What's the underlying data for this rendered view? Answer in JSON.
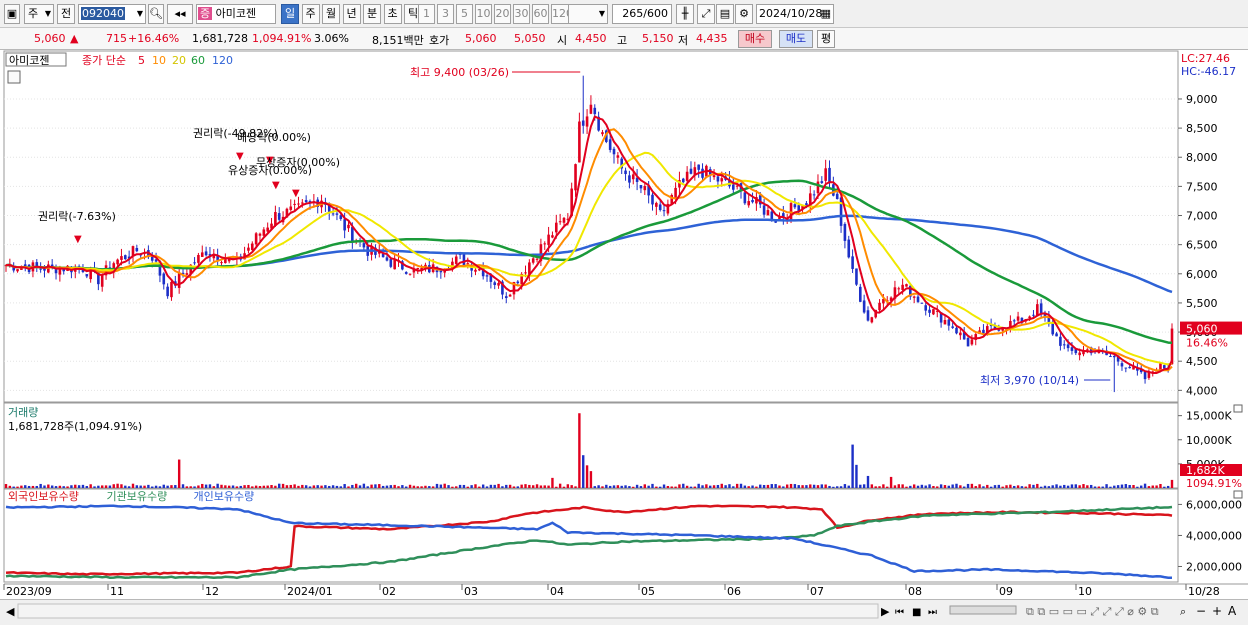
{
  "toolbar": {
    "period_type": "주",
    "prev_label": "전",
    "code": "092040",
    "stock_badge": "증",
    "stock_name": "아미코젠",
    "tabs": [
      "일",
      "주",
      "월",
      "년",
      "분",
      "초",
      "틱"
    ],
    "active_tab": "일",
    "nums": [
      "1",
      "3",
      "5",
      "10",
      "20",
      "30",
      "60",
      "120"
    ],
    "count": "265",
    "count_total": "/600",
    "date": "2024/10/28"
  },
  "quote": {
    "price": "5,060",
    "up_arrow": "▲",
    "change": "715",
    "change_pct": "+16.46%",
    "volume": "1,681,728",
    "volume_pct": "1,094.91%",
    "turnover": "3.06%",
    "amount": "8,151백만",
    "ask_label": "호가",
    "ask1": "5,060",
    "ask2": "5,050",
    "open_label": "시",
    "open": "4,450",
    "high_label": "고",
    "high": "5,150",
    "low_label": "저",
    "low": "4,435",
    "buy": "매수",
    "sell": "매도",
    "flag": "평"
  },
  "colors": {
    "up": "#e1001e",
    "down": "#1c2fc7",
    "ma5": "#e1001e",
    "ma10": "#ff8c00",
    "ma20": "#f0e800",
    "ma60": "#1a9a3a",
    "ma120": "#2e62d6"
  },
  "chart_data": [
    {
      "type": "candlestick",
      "title": "아미코젠",
      "legend": {
        "close_label": "종가",
        "method": "단순",
        "periods": [
          "5",
          "10",
          "20",
          "60",
          "120"
        ]
      },
      "ylim": [
        3800,
        9600
      ],
      "y_ticks": [
        "9,000",
        "8,500",
        "8,000",
        "7,500",
        "7,000",
        "6,500",
        "6,000",
        "5,500",
        "5,000",
        "4,500",
        "4,000"
      ],
      "x_ticks": [
        "2023/09",
        "11",
        "12",
        "2024/01",
        "02",
        "03",
        "04",
        "05",
        "06",
        "07",
        "08",
        "09",
        "10",
        "10/28"
      ],
      "lc": "LC:27.46",
      "hc": "HC:-46.17",
      "last_price": "5,060",
      "last_pct": "16.46%",
      "high_annotation": "최고 9,400 (03/26)",
      "low_annotation": "최저 3,970 (10/14)",
      "events": [
        "권리락(-7.63%)",
        "권리락(-49.82%)",
        "배당락(0.00%)",
        "무상증자(0.00%)",
        "유상증자(0.00%)"
      ],
      "series": [
        {
          "name": "5",
          "period": 5
        },
        {
          "name": "10",
          "period": 10
        },
        {
          "name": "20",
          "period": 20
        },
        {
          "name": "60",
          "period": 60
        },
        {
          "name": "120",
          "period": 120
        }
      ],
      "keypoints_close": [
        [
          0,
          6150
        ],
        [
          10,
          6100
        ],
        [
          20,
          6100
        ],
        [
          24,
          5900
        ],
        [
          28,
          6200
        ],
        [
          34,
          6400
        ],
        [
          38,
          6300
        ],
        [
          42,
          5700
        ],
        [
          46,
          6000
        ],
        [
          52,
          6400
        ],
        [
          56,
          6300
        ],
        [
          60,
          6200
        ],
        [
          66,
          6700
        ],
        [
          70,
          7000
        ],
        [
          76,
          7100
        ],
        [
          82,
          7300
        ],
        [
          88,
          6800
        ],
        [
          94,
          6400
        ],
        [
          100,
          6200
        ],
        [
          106,
          6050
        ],
        [
          112,
          6100
        ],
        [
          118,
          6250
        ],
        [
          124,
          6050
        ],
        [
          130,
          5650
        ],
        [
          136,
          6200
        ],
        [
          142,
          6700
        ],
        [
          146,
          7000
        ],
        [
          149,
          8500
        ],
        [
          152,
          9000
        ],
        [
          155,
          8400
        ],
        [
          160,
          7800
        ],
        [
          166,
          7400
        ],
        [
          170,
          7000
        ],
        [
          175,
          7500
        ],
        [
          180,
          7800
        ],
        [
          188,
          7500
        ],
        [
          196,
          7150
        ],
        [
          200,
          6950
        ],
        [
          208,
          7250
        ],
        [
          213,
          7700
        ],
        [
          216,
          7200
        ],
        [
          220,
          6000
        ],
        [
          224,
          5200
        ],
        [
          228,
          5600
        ],
        [
          233,
          5800
        ],
        [
          240,
          5400
        ],
        [
          246,
          5100
        ],
        [
          250,
          4800
        ],
        [
          254,
          5000
        ],
        [
          258,
          5100
        ],
        [
          264,
          5200
        ],
        [
          268,
          5400
        ],
        [
          272,
          5000
        ],
        [
          276,
          4650
        ],
        [
          282,
          4700
        ],
        [
          288,
          4550
        ],
        [
          292,
          4400
        ],
        [
          296,
          4200
        ],
        [
          299,
          4400
        ],
        [
          302,
          4400
        ],
        [
          303,
          5060
        ]
      ]
    },
    {
      "type": "bar",
      "title": "거래량",
      "subtitle": "1,681,728주(1,094.91%)",
      "y_ticks": [
        "15,000K",
        "10,000K",
        "5,000K"
      ],
      "ylim": [
        0,
        17000000
      ],
      "last_value": "1,682K",
      "last_pct": "1094.91%",
      "spikes": [
        [
          45,
          5900000
        ],
        [
          142,
          2100000
        ],
        [
          149,
          15500000
        ],
        [
          150,
          6800000
        ],
        [
          151,
          4700000
        ],
        [
          152,
          3500000
        ],
        [
          220,
          9000000
        ],
        [
          221,
          4800000
        ],
        [
          224,
          2500000
        ],
        [
          230,
          2300000
        ],
        [
          303,
          1681728
        ]
      ]
    },
    {
      "type": "line",
      "legend": [
        "외국인보유수량",
        "기관보유수량",
        "개인보유수량"
      ],
      "y_ticks": [
        "6,000,000",
        "4,000,000",
        "2,000,000"
      ],
      "ylim": [
        1000000,
        6800000
      ],
      "series": [
        {
          "name": "외국인보유수량",
          "keypoints": [
            [
              0,
              1600000
            ],
            [
              20,
              1500000
            ],
            [
              60,
              1600000
            ],
            [
              74,
              2000000
            ],
            [
              75,
              4600000
            ],
            [
              100,
              4400000
            ],
            [
              126,
              4900000
            ],
            [
              135,
              5400000
            ],
            [
              150,
              5800000
            ],
            [
              160,
              5500000
            ],
            [
              180,
              5900000
            ],
            [
              200,
              5850000
            ],
            [
              212,
              5700000
            ],
            [
              216,
              4500000
            ],
            [
              225,
              5000000
            ],
            [
              240,
              5400000
            ],
            [
              260,
              5500000
            ],
            [
              280,
              5450000
            ],
            [
              303,
              5300000
            ]
          ]
        },
        {
          "name": "기관보유수량",
          "keypoints": [
            [
              0,
              1400000
            ],
            [
              30,
              1300000
            ],
            [
              60,
              1300000
            ],
            [
              74,
              1800000
            ],
            [
              100,
              2300000
            ],
            [
              118,
              3000000
            ],
            [
              126,
              3300000
            ],
            [
              138,
              3700000
            ],
            [
              146,
              3400000
            ],
            [
              160,
              3600000
            ],
            [
              200,
              3800000
            ],
            [
              210,
              4000000
            ],
            [
              216,
              4600000
            ],
            [
              225,
              4900000
            ],
            [
              240,
              5300000
            ],
            [
              270,
              5500000
            ],
            [
              300,
              5800000
            ],
            [
              303,
              5800000
            ]
          ]
        },
        {
          "name": "개인보유수량",
          "keypoints": [
            [
              0,
              5800000
            ],
            [
              30,
              5900000
            ],
            [
              60,
              5700000
            ],
            [
              74,
              4800000
            ],
            [
              110,
              4600000
            ],
            [
              138,
              4400000
            ],
            [
              142,
              4800000
            ],
            [
              146,
              4200000
            ],
            [
              180,
              4000000
            ],
            [
              205,
              3800000
            ],
            [
              212,
              3400000
            ],
            [
              225,
              2700000
            ],
            [
              236,
              1700000
            ],
            [
              255,
              1800000
            ],
            [
              270,
              1700000
            ],
            [
              290,
              1500000
            ],
            [
              303,
              1300000
            ]
          ]
        }
      ]
    }
  ]
}
